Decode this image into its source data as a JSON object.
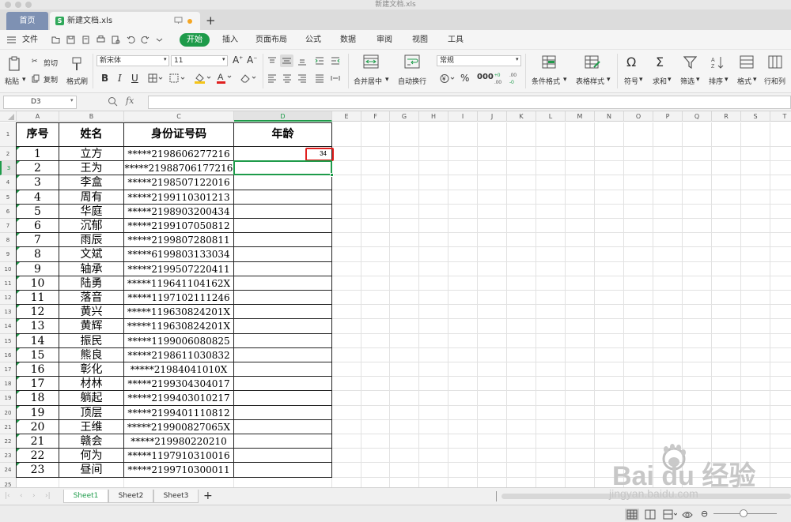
{
  "window": {
    "title": "新建文档.xls"
  },
  "tabs": {
    "home": "首页",
    "doc": "新建文档.xls"
  },
  "menu": {
    "file": "文件",
    "start": "开始",
    "insert": "插入",
    "page_layout": "页面布局",
    "formula": "公式",
    "data": "数据",
    "review": "审阅",
    "view": "视图",
    "tools": "工具"
  },
  "ribbon": {
    "paste": "粘贴",
    "cut": "剪切",
    "copy": "复制",
    "format_painter": "格式刷",
    "font_name": "新宋体",
    "font_size": "11",
    "merge_center": "合并居中",
    "wrap_text": "自动换行",
    "number_format": "常规",
    "conditional_format": "条件格式",
    "table_style": "表格样式",
    "symbol": "符号",
    "sum": "求和",
    "filter": "筛选",
    "sort": "排序",
    "format": "格式",
    "row_col": "行和列"
  },
  "formula_bar": {
    "cell_ref": "D3",
    "fx": "fx",
    "content": ""
  },
  "columns": [
    "A",
    "B",
    "C",
    "D",
    "E",
    "F",
    "G",
    "H",
    "I",
    "J",
    "K",
    "L",
    "M",
    "N",
    "O",
    "P",
    "Q",
    "R",
    "S",
    "T"
  ],
  "table": {
    "headers": [
      "序号",
      "姓名",
      "身份证号码",
      "年龄"
    ],
    "rows": [
      {
        "no": "1",
        "name": "立方",
        "id": "*****2198606277216",
        "age": "34"
      },
      {
        "no": "2",
        "name": "王为",
        "id": "*****21988706177216",
        "age": ""
      },
      {
        "no": "3",
        "name": "李盒",
        "id": "*****2198507122016",
        "age": ""
      },
      {
        "no": "4",
        "name": "周有",
        "id": "*****2199110301213",
        "age": ""
      },
      {
        "no": "5",
        "name": "华庭",
        "id": "*****2198903200434",
        "age": ""
      },
      {
        "no": "6",
        "name": "沉郁",
        "id": "*****2199107050812",
        "age": ""
      },
      {
        "no": "7",
        "name": "雨辰",
        "id": "*****2199807280811",
        "age": ""
      },
      {
        "no": "8",
        "name": "文斌",
        "id": "*****6199803133034",
        "age": ""
      },
      {
        "no": "9",
        "name": "轴承",
        "id": "*****2199507220411",
        "age": ""
      },
      {
        "no": "10",
        "name": "陆勇",
        "id": "*****119641104162X",
        "age": ""
      },
      {
        "no": "11",
        "name": "落音",
        "id": "*****1197102111246",
        "age": ""
      },
      {
        "no": "12",
        "name": "黄兴",
        "id": "*****119630824201X",
        "age": ""
      },
      {
        "no": "13",
        "name": "黄辉",
        "id": "*****119630824201X",
        "age": ""
      },
      {
        "no": "14",
        "name": "振民",
        "id": "*****1199006080825",
        "age": ""
      },
      {
        "no": "15",
        "name": "熊良",
        "id": "*****2198611030832",
        "age": ""
      },
      {
        "no": "16",
        "name": "彰化",
        "id": "*****21984041010X",
        "age": ""
      },
      {
        "no": "17",
        "name": "材林",
        "id": "*****2199304304017",
        "age": ""
      },
      {
        "no": "18",
        "name": "躺起",
        "id": "*****2199403010217",
        "age": ""
      },
      {
        "no": "19",
        "name": "顶层",
        "id": "*****2199401110812",
        "age": ""
      },
      {
        "no": "20",
        "name": "王维",
        "id": "*****219900827065X",
        "age": ""
      },
      {
        "no": "21",
        "name": "赣会",
        "id": "*****219980220210",
        "age": ""
      },
      {
        "no": "22",
        "name": "何为",
        "id": "*****1197910310016",
        "age": ""
      },
      {
        "no": "23",
        "name": "昼间",
        "id": "*****2199710300011",
        "age": ""
      }
    ]
  },
  "sheets": [
    "Sheet1",
    "Sheet2",
    "Sheet3"
  ],
  "active_sheet": "Sheet1",
  "watermark": {
    "brand": "Bai du 经验",
    "url": "jingyan.baidu.com"
  },
  "colors": {
    "accent": "#1e9b4a",
    "highlight": "#e0201f",
    "home_tab": "#7e91b3"
  }
}
